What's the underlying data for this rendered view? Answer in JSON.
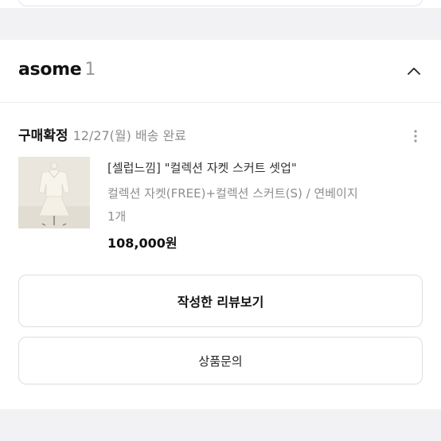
{
  "store": {
    "name": "asome",
    "count": "1"
  },
  "order": {
    "status": "구매확정",
    "date_delivery": "12/27(월) 배송 완료"
  },
  "product": {
    "name": "[셀럽느낌] \"컬렉션 자켓 스커트 셋업\"",
    "option": "컬렉션 자켓(FREE)+컬렉션 스커트(S) / 연베이지",
    "quantity": "1개",
    "price": "108,000원"
  },
  "buttons": {
    "review": "작성한 리뷰보기",
    "inquiry": "상품문의"
  },
  "icons": {
    "collapse": "chevron-up-icon",
    "more": "more-vertical-icon"
  }
}
